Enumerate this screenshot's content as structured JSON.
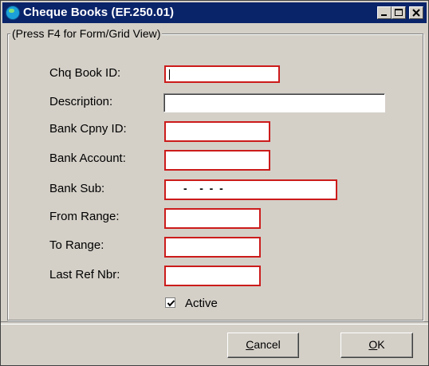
{
  "window": {
    "title": "Cheque Books (EF.250.01)",
    "titlebar_color": "#0a246a",
    "controls": [
      "minimize-icon",
      "maximize-icon",
      "close-icon"
    ]
  },
  "group": {
    "legend": "(Press F4 for Form/Grid View)"
  },
  "fields": [
    {
      "label": "Chq Book ID:",
      "value": "",
      "required": true
    },
    {
      "label": "Description:",
      "value": "",
      "required": false
    },
    {
      "label": "Bank Cpny ID:",
      "value": "",
      "required": true
    },
    {
      "label": "Bank Account:",
      "value": "",
      "required": true
    },
    {
      "label": "Bank Sub:",
      "value": "-    -  -  -",
      "required": true
    },
    {
      "label": "From Range:",
      "value": "",
      "required": true
    },
    {
      "label": "To Range:",
      "value": "",
      "required": true
    },
    {
      "label": "Last Ref Nbr:",
      "value": "",
      "required": true
    }
  ],
  "active": {
    "label": "Active",
    "checked": true
  },
  "buttons": {
    "cancel": {
      "mnemonic": "C",
      "rest": "ancel"
    },
    "ok": {
      "mnemonic": "O",
      "rest": "K"
    }
  },
  "colors": {
    "required_border": "#cc1b1b",
    "dialog_face": "#d4d0c8"
  }
}
